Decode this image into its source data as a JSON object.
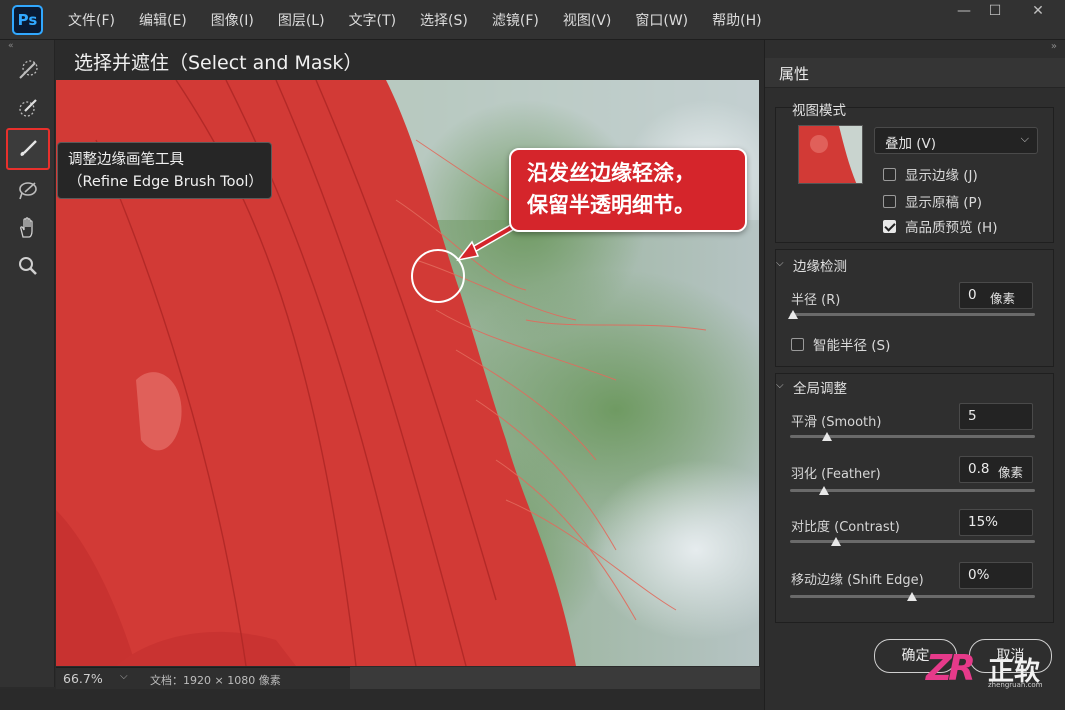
{
  "app": {
    "logo": "Ps"
  },
  "menu": [
    "文件(F)",
    "编辑(E)",
    "图像(I)",
    "图层(L)",
    "文字(T)",
    "选择(S)",
    "滤镜(F)",
    "视图(V)",
    "窗口(W)",
    "帮助(H)"
  ],
  "window_controls": {
    "minimize": "—",
    "maximize": "☐",
    "close": "✕"
  },
  "document": {
    "title": "选择并遮住（Select and Mask）"
  },
  "tools": [
    "quick-selection",
    "refine-edge-brush",
    "brush",
    "lasso",
    "hand",
    "zoom"
  ],
  "tooltip": {
    "line1": "调整边缘画笔工具",
    "line2": "（Refine Edge Brush Tool）"
  },
  "callout": {
    "line1": "沿发丝边缘轻涂，",
    "line2": "保留半透明细节。"
  },
  "status": {
    "zoom": "66.7%",
    "doc_info": "文档：1920 × 1080 像素"
  },
  "panel": {
    "title": "属性",
    "view_mode": {
      "title": "视图模式",
      "selected": "叠加 (V)",
      "options": [
        {
          "label": "显示边缘 (J)",
          "checked": false
        },
        {
          "label": "显示原稿 (P)",
          "checked": false
        },
        {
          "label": "高品质预览 (H)",
          "checked": true
        }
      ]
    },
    "edge_detection": {
      "title": "边缘检测",
      "radius_label": "半径 (R)",
      "radius_value": "0",
      "radius_unit": "像素",
      "radius_level": 0.0,
      "smart_radius_label": "智能半径 (S)",
      "smart_radius_checked": false
    },
    "global_refine": {
      "title": "全局调整",
      "smooth_label": "平滑 (Smooth)",
      "smooth_value": "5",
      "smooth_level": 0.14,
      "feather_label": "羽化 (Feather)",
      "feather_value": "0.8",
      "feather_unit": "像素",
      "feather_level": 0.13,
      "contrast_label": "对比度 (Contrast)",
      "contrast_value": "15%",
      "contrast_level": 0.18,
      "shift_label": "移动边缘 (Shift Edge)",
      "shift_value": "0%",
      "shift_level": 0.5
    },
    "ok_label": "确定",
    "cancel_label": "取消"
  },
  "watermark": {
    "mark": "ZR",
    "name": "正软",
    "url": "zhengruan.com"
  },
  "colors": {
    "overlay_red": "#d63a3a",
    "accent_red": "#d5252b",
    "ps_blue": "#31a8ff"
  }
}
